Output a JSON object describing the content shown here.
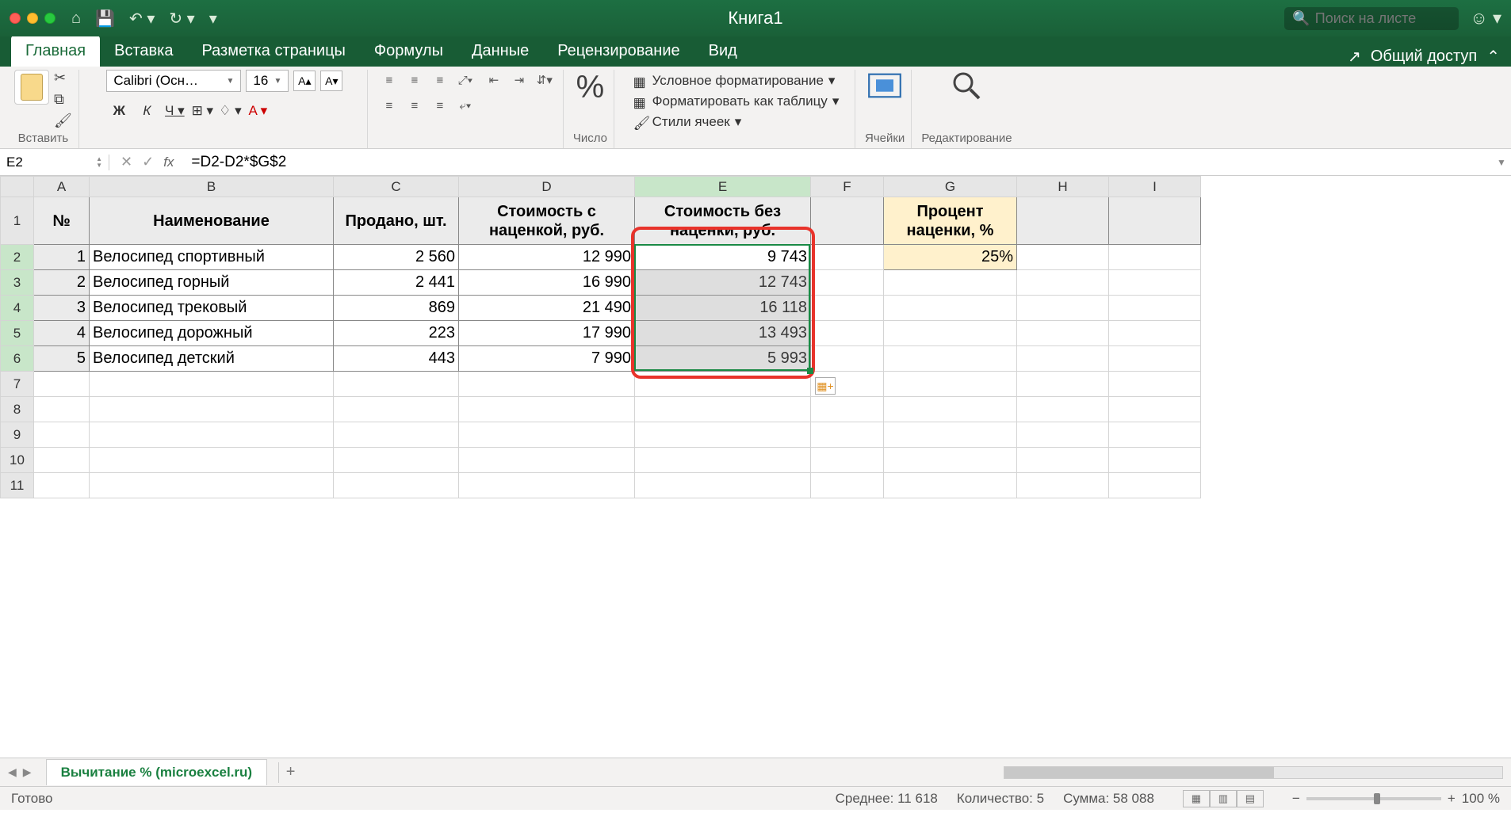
{
  "window": {
    "title": "Книга1"
  },
  "search": {
    "placeholder": "Поиск на листе"
  },
  "tabs": {
    "home": "Главная",
    "insert": "Вставка",
    "layout": "Разметка страницы",
    "formulas": "Формулы",
    "data": "Данные",
    "review": "Рецензирование",
    "view": "Вид",
    "share": "Общий доступ"
  },
  "ribbon": {
    "paste": "Вставить",
    "font_name": "Calibri (Осн…",
    "font_size": "16",
    "number_group": "Число",
    "cond_fmt": "Условное форматирование",
    "as_table": "Форматировать как таблицу",
    "cell_styles": "Стили ячеек",
    "cells": "Ячейки",
    "editing": "Редактирование"
  },
  "name_box": "E2",
  "formula": "=D2-D2*$G$2",
  "columns": [
    "A",
    "B",
    "C",
    "D",
    "E",
    "F",
    "G",
    "H",
    "I"
  ],
  "headers": {
    "a": "№",
    "b": "Наименование",
    "c": "Продано, шт.",
    "d": "Стоимость с наценкой, руб.",
    "e": "Стоимость без наценки, руб.",
    "g": "Процент наценки, %"
  },
  "g_value": "25%",
  "rows": [
    {
      "n": "1",
      "name": "Велосипед спортивный",
      "sold": "2 560",
      "cost": "12 990",
      "net": "9 743"
    },
    {
      "n": "2",
      "name": "Велосипед горный",
      "sold": "2 441",
      "cost": "16 990",
      "net": "12 743"
    },
    {
      "n": "3",
      "name": "Велосипед трековый",
      "sold": "869",
      "cost": "21 490",
      "net": "16 118"
    },
    {
      "n": "4",
      "name": "Велосипед дорожный",
      "sold": "223",
      "cost": "17 990",
      "net": "13 493"
    },
    {
      "n": "5",
      "name": "Велосипед детский",
      "sold": "443",
      "cost": "7 990",
      "net": "5 993"
    }
  ],
  "sheet_tab": "Вычитание % (microexcel.ru)",
  "status": {
    "ready": "Готово",
    "avg": "Среднее: 11 618",
    "count": "Количество: 5",
    "sum": "Сумма: 58 088",
    "zoom": "100 %"
  }
}
